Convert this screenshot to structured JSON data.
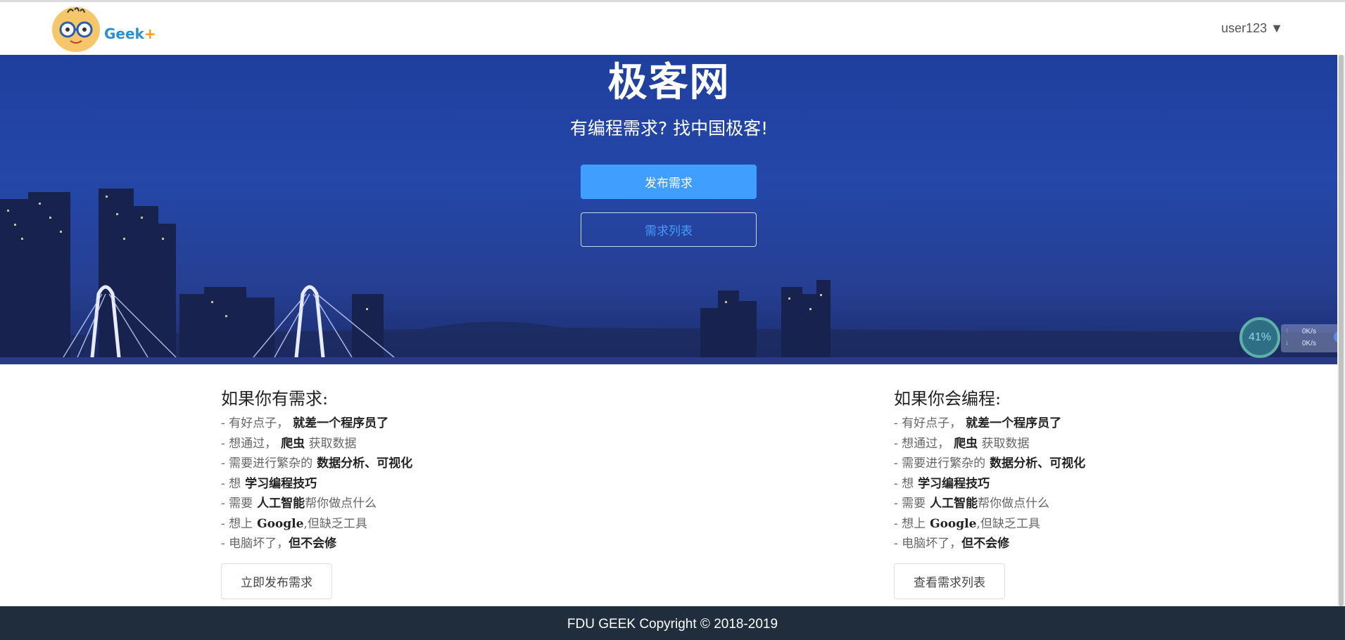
{
  "header": {
    "logo_text": "Geek",
    "logo_plus": "+",
    "user_menu": "user123 ▼"
  },
  "hero": {
    "title": "极客网",
    "subtitle": "有编程需求? 找中国极客!",
    "primary_button": "发布需求",
    "secondary_button": "需求列表"
  },
  "speed_widget": {
    "percent": "41%",
    "upload": "0K/s",
    "download": "0K/s"
  },
  "left_column": {
    "heading": "如果你有需求:",
    "items": [
      {
        "prefix": "- 有好点子，",
        "strong": " 就差一个程序员了",
        "suffix": ""
      },
      {
        "prefix": "- 想通过，",
        "strong": " 爬虫",
        "suffix": " 获取数据"
      },
      {
        "prefix": "- 需要进行繁杂的",
        "strong": " 数据分析、可视化",
        "suffix": ""
      },
      {
        "prefix": "- 想",
        "strong": " 学习编程技巧",
        "suffix": ""
      },
      {
        "prefix": "- 需要",
        "strong": " 人工智能",
        "suffix": "帮你做点什么"
      },
      {
        "prefix": "- 想上",
        "strong": " Google",
        "suffix": ",但缺乏工具"
      },
      {
        "prefix": "- 电脑坏了，",
        "strong": "但不会修",
        "suffix": ""
      }
    ],
    "button": "立即发布需求"
  },
  "right_column": {
    "heading": "如果你会编程:",
    "items": [
      {
        "prefix": "- 有好点子，",
        "strong": " 就差一个程序员了",
        "suffix": ""
      },
      {
        "prefix": "- 想通过，",
        "strong": " 爬虫",
        "suffix": " 获取数据"
      },
      {
        "prefix": "- 需要进行繁杂的",
        "strong": " 数据分析、可视化",
        "suffix": ""
      },
      {
        "prefix": "- 想",
        "strong": " 学习编程技巧",
        "suffix": ""
      },
      {
        "prefix": "- 需要",
        "strong": " 人工智能",
        "suffix": "帮你做点什么"
      },
      {
        "prefix": "- 想上",
        "strong": " Google",
        "suffix": ",但缺乏工具"
      },
      {
        "prefix": "- 电脑坏了，",
        "strong": "但不会修",
        "suffix": ""
      }
    ],
    "button": "查看需求列表"
  },
  "footer": {
    "text": "FDU GEEK Copyright © 2018-2019"
  },
  "colors": {
    "primary": "#409eff",
    "footer_bg": "#1f2d3d",
    "hero_bg": "#2447a8"
  }
}
